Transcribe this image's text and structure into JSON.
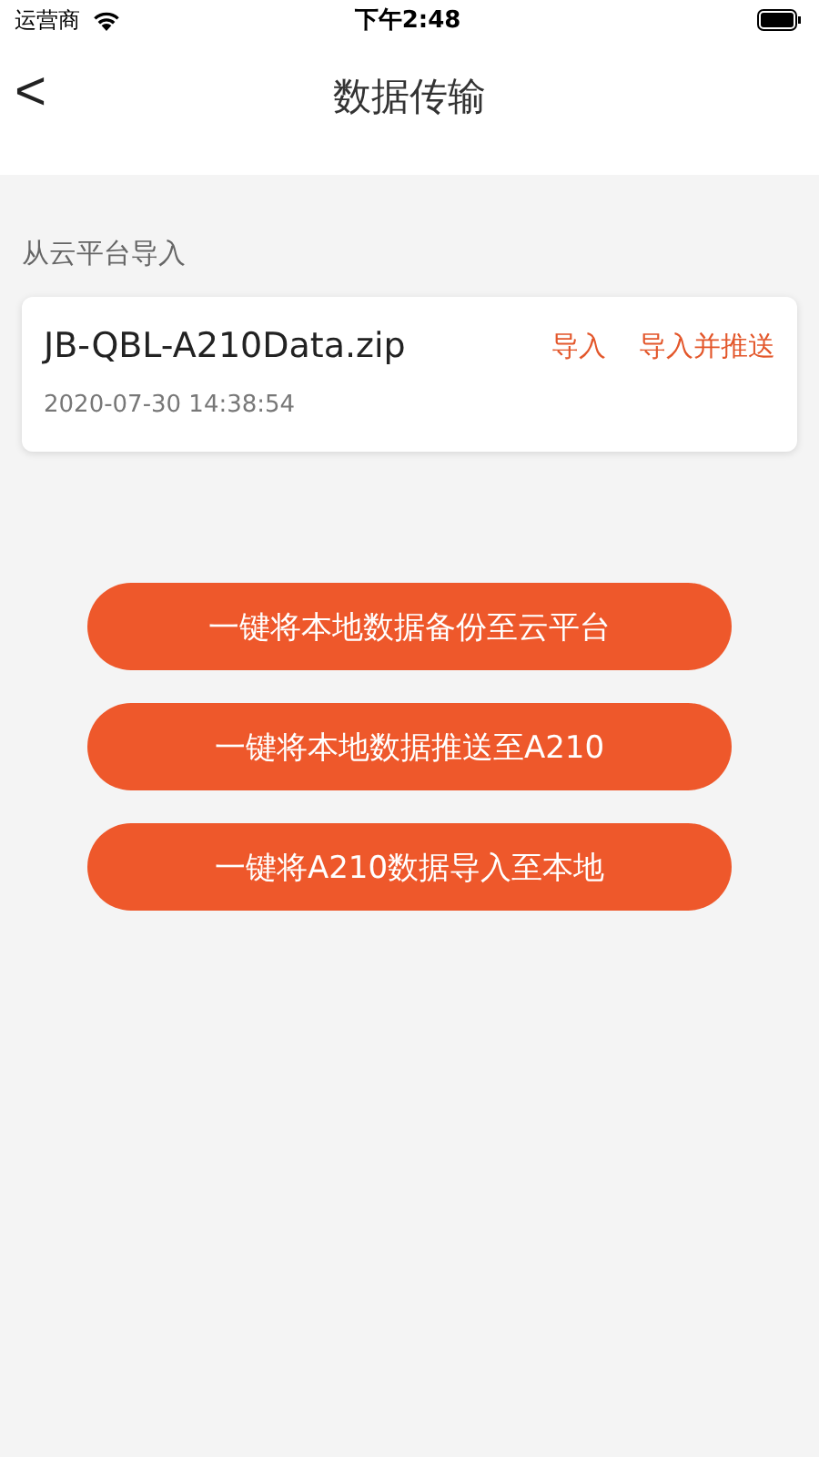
{
  "status_bar": {
    "carrier": "运营商",
    "time": "下午2:48"
  },
  "nav": {
    "back": "<",
    "title": "数据传输"
  },
  "section_title": "从云平台导入",
  "files": [
    {
      "name": "JB-QBL-A210Data.zip",
      "date": "2020-07-30 14:38:54",
      "actions": [
        "导入",
        "导入并推送"
      ]
    }
  ],
  "buttons": [
    "一键将本地数据备份至云平台",
    "一键将本地数据推送至A210",
    "一键将A210数据导入至本地"
  ]
}
